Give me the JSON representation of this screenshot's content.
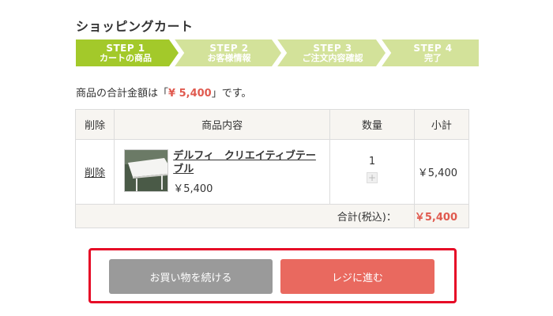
{
  "page": {
    "title": "ショッピングカート"
  },
  "steps": [
    {
      "num": "STEP 1",
      "label": "カートの商品",
      "active": true
    },
    {
      "num": "STEP 2",
      "label": "お客様情報",
      "active": false
    },
    {
      "num": "STEP 3",
      "label": "ご注文内容確認",
      "active": false
    },
    {
      "num": "STEP 4",
      "label": "完了",
      "active": false
    }
  ],
  "colors": {
    "step_active": "#a3c92a",
    "step_inactive": "#d3e29a",
    "accent_red": "#e05a4f",
    "button_gray": "#9a9a9a",
    "button_red": "#e9695f",
    "highlight_border": "#e60a26"
  },
  "summary": {
    "prefix": "商品の合計金額は「",
    "amount": "¥ 5,400",
    "suffix": "」です。"
  },
  "table": {
    "headers": {
      "delete": "削除",
      "item": "商品内容",
      "quantity": "数量",
      "subtotal": "小計"
    },
    "rows": [
      {
        "delete_label": "削除",
        "name": "デルフィ　クリエイティブテーブル",
        "price": "￥5,400",
        "quantity": "1",
        "plus_icon": "+",
        "subtotal": "￥5,400"
      }
    ],
    "total_label": "合計(税込)：",
    "total_value": "￥5,400"
  },
  "actions": {
    "continue_label": "お買い物を続ける",
    "checkout_label": "レジに進む"
  }
}
